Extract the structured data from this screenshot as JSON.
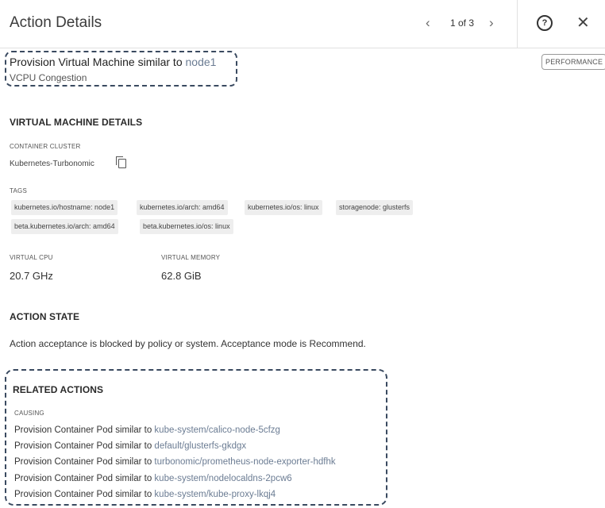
{
  "header": {
    "title": "Action Details",
    "prev_icon": "chevron-left",
    "pager": "1 of 3",
    "next_icon": "chevron-right",
    "help_icon": "question-circle",
    "close_icon": "close"
  },
  "action": {
    "title_prefix": "Provision Virtual Machine similar to ",
    "title_target": "node1",
    "subtitle": "VCPU Congestion",
    "badge": "PERFORMANCE"
  },
  "vm_details": {
    "heading": "VIRTUAL MACHINE DETAILS",
    "cluster_label": "CONTAINER CLUSTER",
    "cluster_value": "Kubernetes-Turbonomic",
    "copy_icon": "copy",
    "tags_label": "TAGS",
    "tags": [
      "kubernetes.io/hostname: node1",
      "kubernetes.io/arch: amd64",
      "kubernetes.io/os: linux",
      "storagenode: glusterfs",
      "beta.kubernetes.io/arch: amd64",
      "beta.kubernetes.io/os: linux"
    ],
    "vcpu_label": "VIRTUAL CPU",
    "vcpu_value": "20.7 GHz",
    "vmem_label": "VIRTUAL MEMORY",
    "vmem_value": "62.8 GiB"
  },
  "action_state": {
    "heading": "ACTION STATE",
    "text": "Action acceptance is blocked by policy or system. Acceptance mode is Recommend."
  },
  "related": {
    "heading": "RELATED ACTIONS",
    "causing_label": "CAUSING",
    "prefix": "Provision Container Pod similar to ",
    "items": [
      "kube-system/calico-node-5cfzg",
      "default/glusterfs-gkdgx",
      "turbonomic/prometheus-node-exporter-hdfhk",
      "kube-system/nodelocaldns-2pcw6",
      "kube-system/kube-proxy-lkqj4"
    ]
  },
  "colors": {
    "link": "#6b7c93",
    "annotation_border": "#3a4a60",
    "tag_bg": "#eeeeee"
  }
}
